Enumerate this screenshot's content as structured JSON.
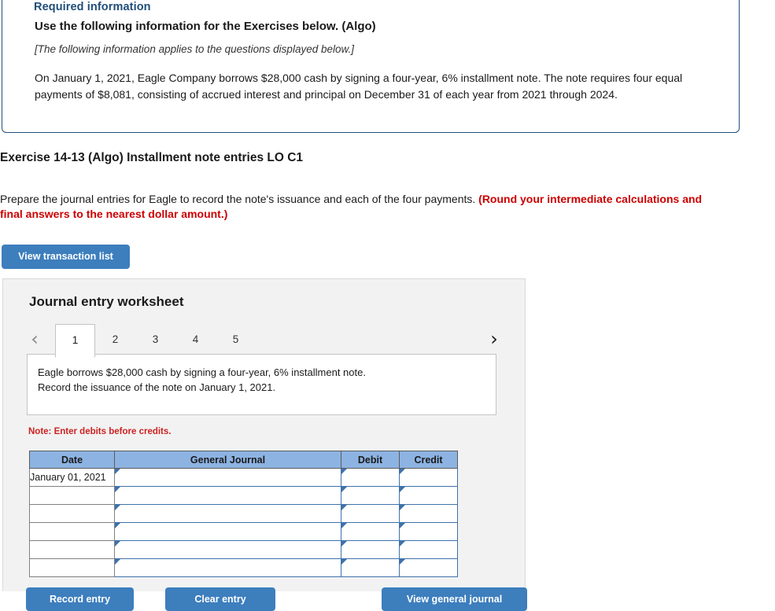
{
  "required_information": {
    "title": "Required information",
    "heading": "Use the following information for the Exercises below. (Algo)",
    "applies_note": "[The following information applies to the questions displayed below.]",
    "body": "On January 1, 2021, Eagle Company borrows $28,000 cash by signing a four-year, 6% installment note. The note requires four equal payments of $8,081, consisting of accrued interest and principal on December 31 of each year from 2021 through 2024."
  },
  "exercise": {
    "title": "Exercise 14-13 (Algo) Installment note entries LO C1",
    "instruction_plain": "Prepare the journal entries for Eagle to record the note's issuance and each of the four payments. ",
    "instruction_emphasis": "(Round your intermediate calculations and final answers to the nearest dollar amount.)",
    "view_transaction_list_label": "View transaction list"
  },
  "worksheet": {
    "title": "Journal entry worksheet",
    "prev_icon": "chevron-left-icon",
    "next_icon": "chevron-right-icon",
    "tabs": [
      {
        "label": "1",
        "active": true
      },
      {
        "label": "2",
        "active": false
      },
      {
        "label": "3",
        "active": false
      },
      {
        "label": "4",
        "active": false
      },
      {
        "label": "5",
        "active": false
      }
    ],
    "active_tab_index": 0,
    "transaction_line1": "Eagle borrows $28,000 cash by signing a four-year, 6% installment note.",
    "transaction_line2": "Record the issuance of the note on January 1, 2021.",
    "note": "Note: Enter debits before credits.",
    "table": {
      "headers": [
        "Date",
        "General Journal",
        "Debit",
        "Credit"
      ],
      "rows": [
        {
          "date": "January 01, 2021",
          "general_journal": "",
          "debit": "",
          "credit": ""
        },
        {
          "date": "",
          "general_journal": "",
          "debit": "",
          "credit": ""
        },
        {
          "date": "",
          "general_journal": "",
          "debit": "",
          "credit": ""
        },
        {
          "date": "",
          "general_journal": "",
          "debit": "",
          "credit": ""
        },
        {
          "date": "",
          "general_journal": "",
          "debit": "",
          "credit": ""
        },
        {
          "date": "",
          "general_journal": "",
          "debit": "",
          "credit": ""
        }
      ]
    },
    "actions": {
      "record_entry_label": "Record entry",
      "clear_entry_label": "Clear entry",
      "view_general_journal_label": "View general journal"
    }
  },
  "colors": {
    "panel_border": "#1f4e79",
    "accent_blue": "#3d7ebd",
    "table_header_blue": "#8db3e2",
    "input_border_blue": "#3f72ab",
    "alert_red": "#cc0000",
    "note_red": "#cc2222",
    "panel_background": "#f2f2f2"
  }
}
